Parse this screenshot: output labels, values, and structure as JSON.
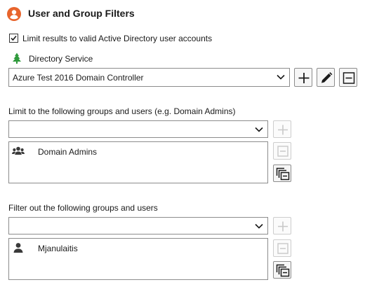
{
  "header": {
    "title": "User and Group Filters",
    "icon": "user-circle-icon",
    "accent_color": "#e8642c"
  },
  "limit_valid_accounts": {
    "label": "Limit results to valid Active Directory user accounts",
    "checked": true
  },
  "directory_service": {
    "label": "Directory Service",
    "icon": "tree-icon",
    "selected": "Azure Test 2016 Domain Controller",
    "buttons": [
      "plus-icon",
      "pencil-icon",
      "minus-box-icon"
    ]
  },
  "include_section": {
    "label": "Limit to the following groups and users (e.g. Domain Admins)",
    "dropdown_value": "",
    "items": [
      {
        "label": "Domain Admins",
        "icon": "group-icon"
      }
    ]
  },
  "exclude_section": {
    "label": "Filter out the following groups and users",
    "dropdown_value": "",
    "items": [
      {
        "label": "Mjanulaitis",
        "icon": "user-icon"
      }
    ]
  }
}
